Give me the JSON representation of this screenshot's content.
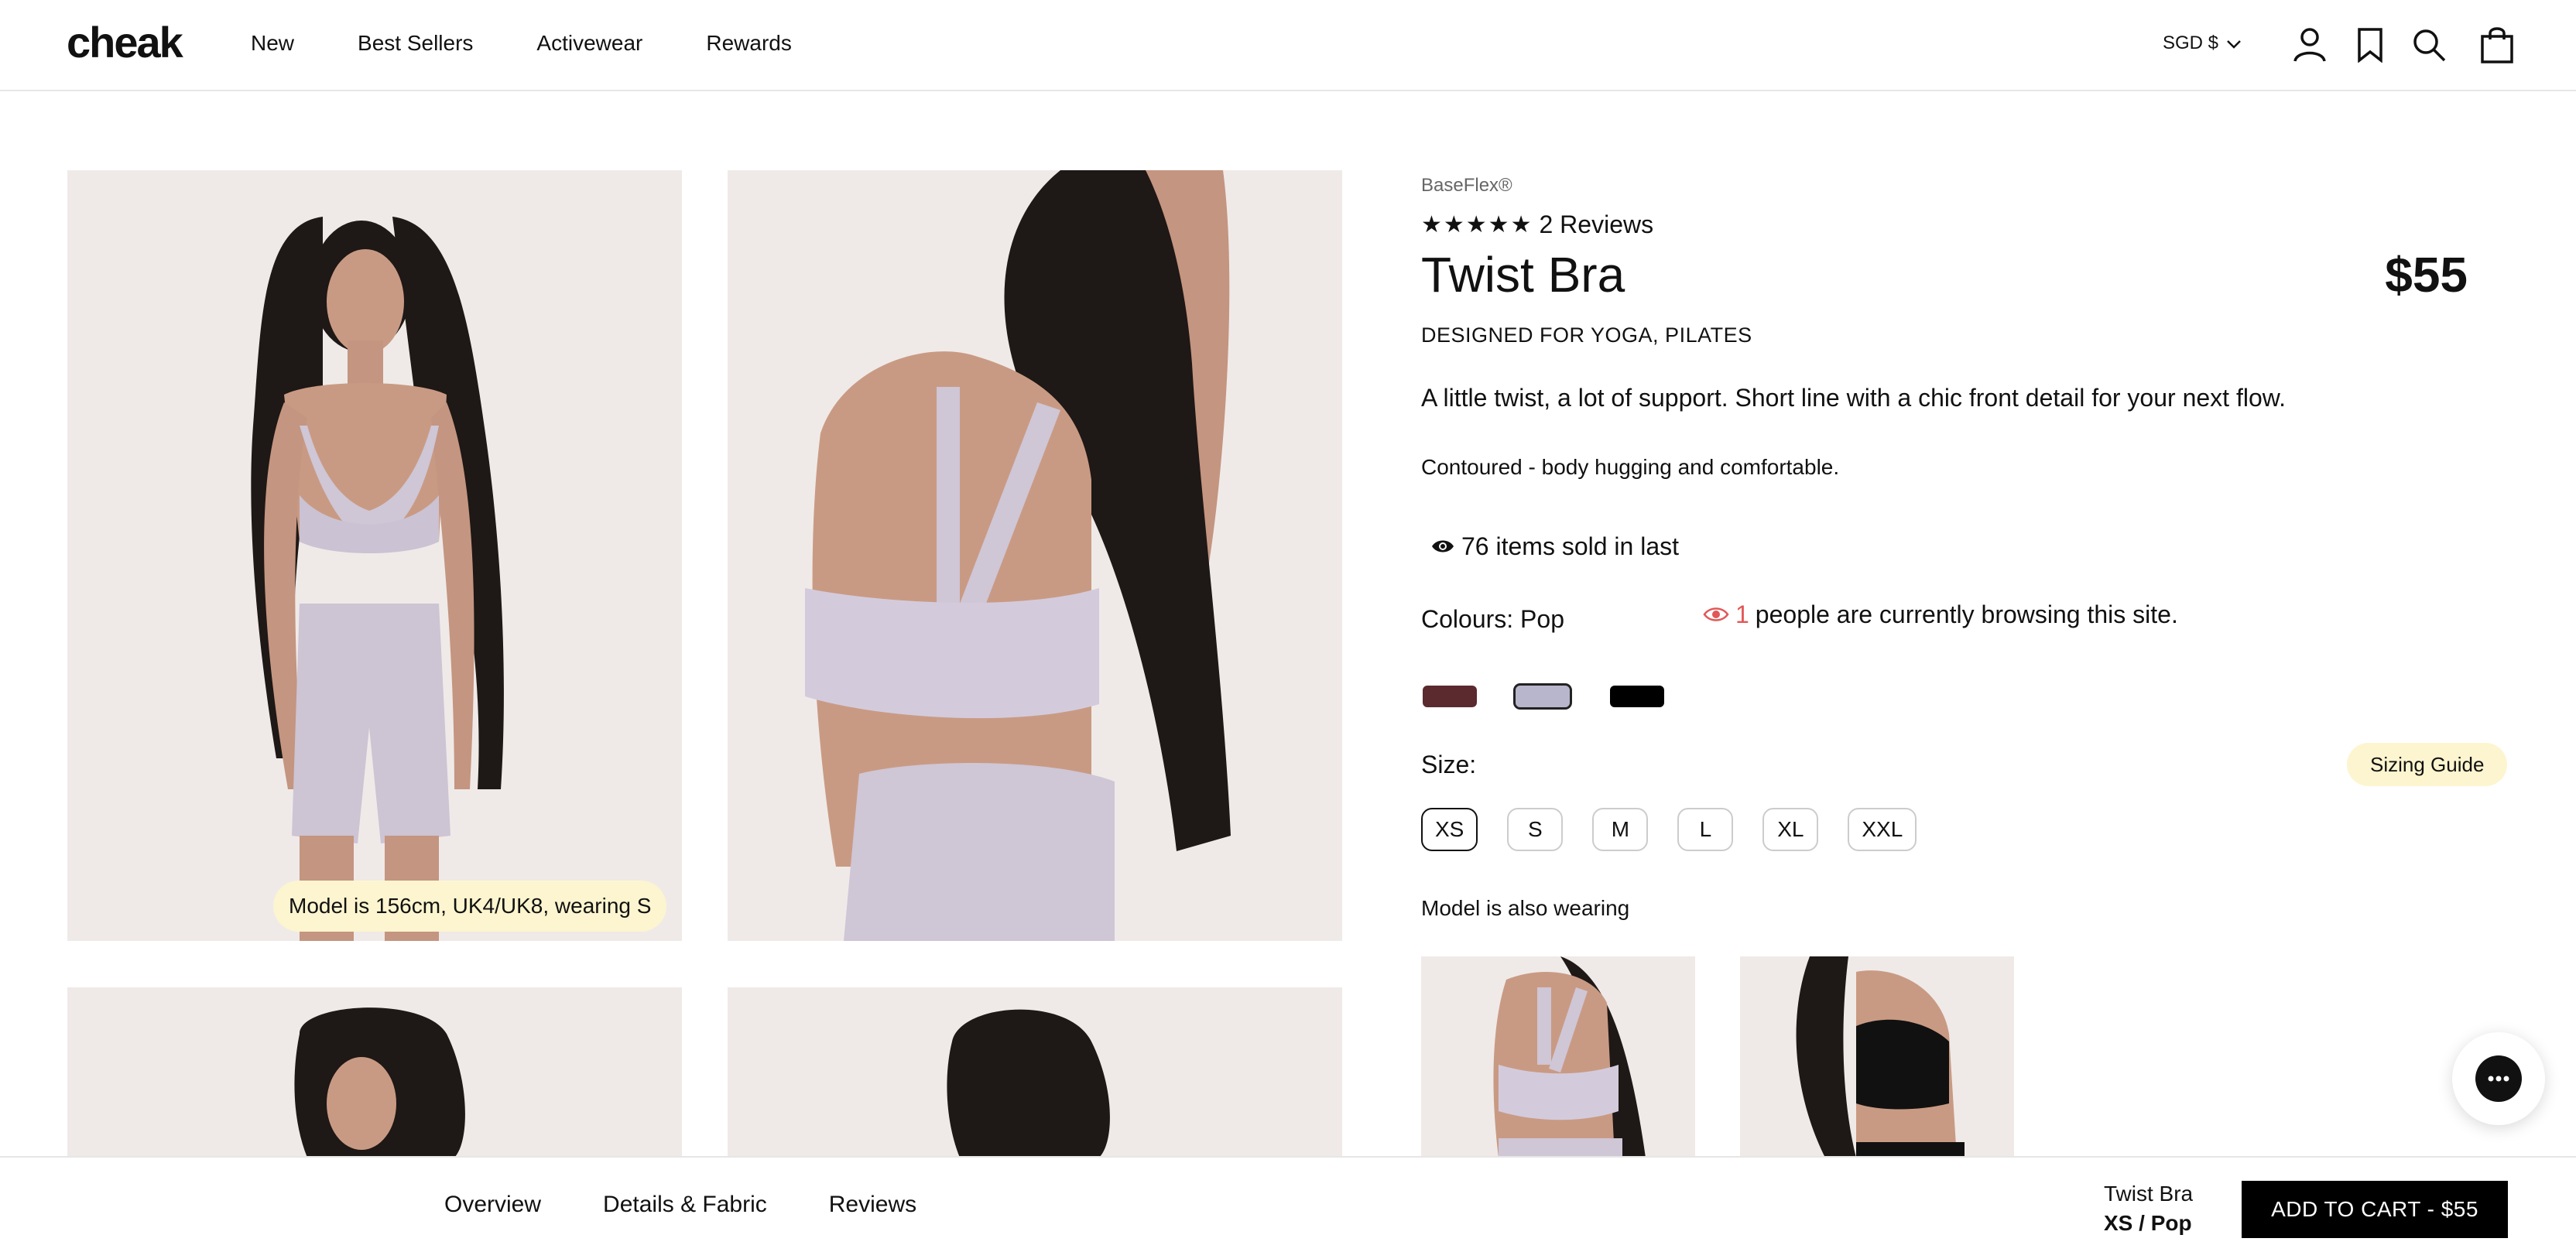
{
  "header": {
    "logo": "cheak",
    "nav": [
      "New",
      "Best Sellers",
      "Activewear",
      "Rewards"
    ],
    "currency": "SGD $"
  },
  "gallery": {
    "model_tag": "Model is 156cm, UK4/UK8, wearing S"
  },
  "product": {
    "brand": "BaseFlex®",
    "stars": "★★★★★",
    "reviews": "2 Reviews",
    "title": "Twist Bra",
    "price": "$55",
    "designed_for": "DESIGNED FOR YOGA, PILATES",
    "description": "A little twist, a lot of support. Short line with a chic front detail for your next flow.",
    "feature": "Contoured - body hugging and comfortable.",
    "sold": "76 items sold in last",
    "colours_label": "Colours: Pop",
    "browsing_count": "1",
    "browsing_text": "people are currently browsing this site.",
    "swatches": [
      "#5a2a2f",
      "#b8b6cc",
      "#000000"
    ],
    "size_label": "Size:",
    "sizing_guide": "Sizing Guide",
    "sizes": [
      "XS",
      "S",
      "M",
      "L",
      "XL",
      "XXL"
    ],
    "selected_size": "XS",
    "also_wearing": "Model is also wearing"
  },
  "bottombar": {
    "tabs": [
      "Overview",
      "Details & Fabric",
      "Reviews"
    ],
    "product_name": "Twist Bra",
    "variant": "XS / Pop",
    "cart_button": "ADD TO CART - $55"
  },
  "colors": {
    "highlight": "#fcf5cf",
    "eye_red": "#e25757"
  }
}
